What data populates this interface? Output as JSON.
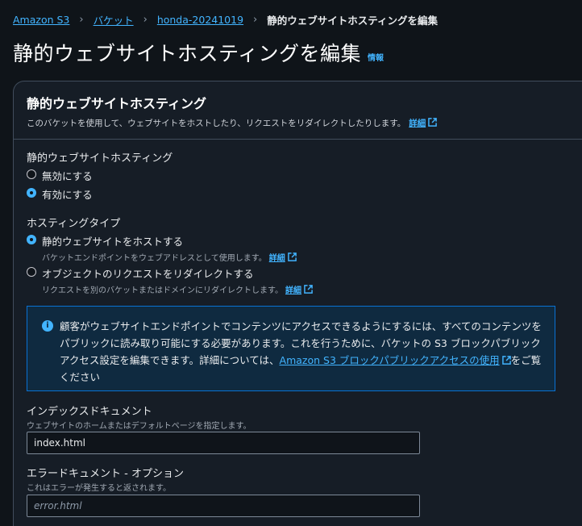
{
  "breadcrumb": {
    "items": [
      "Amazon S3",
      "バケット",
      "honda-20241019"
    ],
    "current": "静的ウェブサイトホスティングを編集",
    "separator": "›"
  },
  "page": {
    "title": "静的ウェブサイトホスティングを編集",
    "info_link": "情報"
  },
  "panel": {
    "heading": "静的ウェブサイトホスティング",
    "description": "このバケットを使用して、ウェブサイトをホストしたり、リクエストをリダイレクトしたりします。",
    "details_link": "詳細"
  },
  "hosting": {
    "label": "静的ウェブサイトホスティング",
    "options": [
      {
        "label": "無効にする",
        "selected": false
      },
      {
        "label": "有効にする",
        "selected": true
      }
    ]
  },
  "hosting_type": {
    "label": "ホスティングタイプ",
    "options": [
      {
        "label": "静的ウェブサイトをホストする",
        "sub": "バケットエンドポイントをウェブアドレスとして使用します。",
        "link": "詳細",
        "selected": true
      },
      {
        "label": "オブジェクトのリクエストをリダイレクトする",
        "sub": "リクエストを別のバケットまたはドメインにリダイレクトします。",
        "link": "詳細",
        "selected": false
      }
    ]
  },
  "alert": {
    "text_before": "顧客がウェブサイトエンドポイントでコンテンツにアクセスできるようにするには、すべてのコンテンツをパブリックに読み取り可能にする必要があります。これを行うために、バケットの S3 ブロックパブリックアクセス設定を編集できます。詳細については、",
    "link": "Amazon S3 ブロックパブリックアクセスの使用",
    "text_after": "をご覧ください"
  },
  "index_document": {
    "label": "インデックスドキュメント",
    "description": "ウェブサイトのホームまたはデフォルトページを指定します。",
    "value": "index.html"
  },
  "error_document": {
    "label": "エラードキュメント - オプション",
    "description": "これはエラーが発生すると返されます。",
    "placeholder": "error.html"
  },
  "colors": {
    "background": "#0f1419",
    "panel": "#161d26",
    "link": "#42b4ff",
    "alert_border": "#0972d3",
    "alert_bg": "#0f2a40"
  }
}
